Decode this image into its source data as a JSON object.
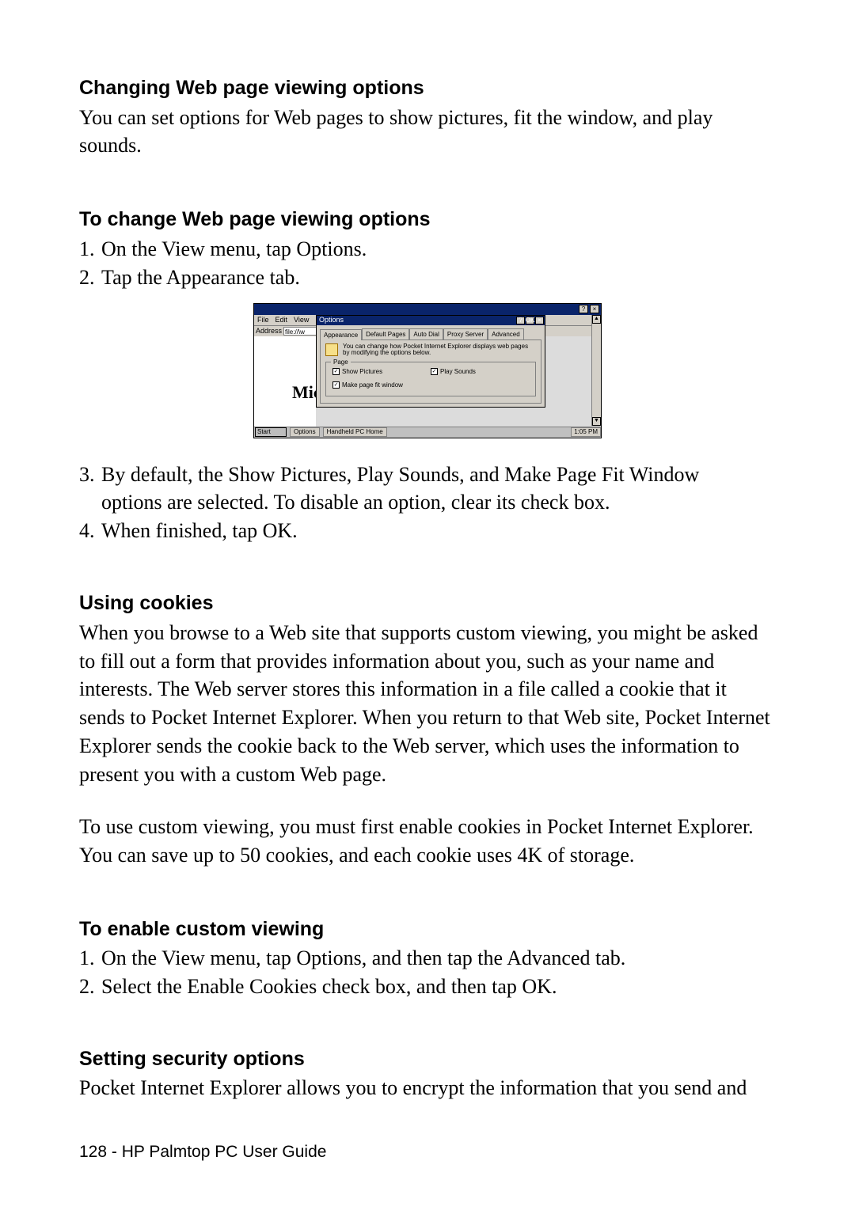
{
  "sections": {
    "s1_heading": "Changing Web page viewing options",
    "s1_body": "You can set options for Web pages to show pictures, fit the window, and play sounds.",
    "s2_heading": "To change Web page viewing options",
    "s2_item1_num": "1.",
    "s2_item1": "On the View menu, tap Options.",
    "s2_item2_num": "2.",
    "s2_item2": "Tap the Appearance tab.",
    "s2_item3_num": "3.",
    "s2_item3a": "By default, the Show Pictures, Play Sounds, and Make Page Fit Window",
    "s2_item3b": "options are selected. To disable an option, clear its check box.",
    "s2_item4_num": "4.",
    "s2_item4": "When finished, tap OK.",
    "s3_heading": "Using cookies",
    "s3_p1": "When you browse to a Web site that supports custom viewing, you might be asked to fill out a form that provides information about you, such as your name and interests. The Web server stores this information in a file called a cookie that it sends to Pocket Internet Explorer. When you return to that Web site, Pocket Internet Explorer sends the cookie back to the Web server, which uses the information to present you with a custom Web page.",
    "s3_p2": "To use custom viewing, you must first enable cookies in Pocket Internet Explorer. You can save up to 50 cookies, and each cookie uses 4K of storage.",
    "s4_heading": "To enable custom viewing",
    "s4_item1_num": "1.",
    "s4_item1": "On the View menu, tap Options, and then tap the Advanced tab.",
    "s4_item2_num": "2.",
    "s4_item2": "Select the Enable Cookies check box, and then tap OK.",
    "s5_heading": "Setting security options",
    "s5_body": "Pocket Internet Explorer allows you to encrypt the information that you send and"
  },
  "shot": {
    "menu_file": "File",
    "menu_edit": "Edit",
    "menu_view": "View",
    "address_label": "Address",
    "address_value": "file://\\w",
    "dialog_title": "Options",
    "tabs": {
      "appearance": "Appearance",
      "default": "Default Pages",
      "autodial": "Auto Dial",
      "proxy": "Proxy Server",
      "advanced": "Advanced"
    },
    "hint": "You can change how Pocket Internet Explorer displays web pages by modifying the options below.",
    "group_legend": "Page",
    "chk_show_pictures": "Show Pictures",
    "chk_play_sounds": "Play Sounds",
    "chk_fit_window": "Make page fit window",
    "mic_glyph": "Mic",
    "help_btn": "?",
    "ok_btn": "OK",
    "close_btn": "×",
    "start": "Start",
    "task1": "Options",
    "task2": "Handheld PC Home",
    "clock": "1:05 PM"
  },
  "footer": {
    "page_num": "128",
    "sep": " - ",
    "title": "HP Palmtop PC User Guide"
  }
}
